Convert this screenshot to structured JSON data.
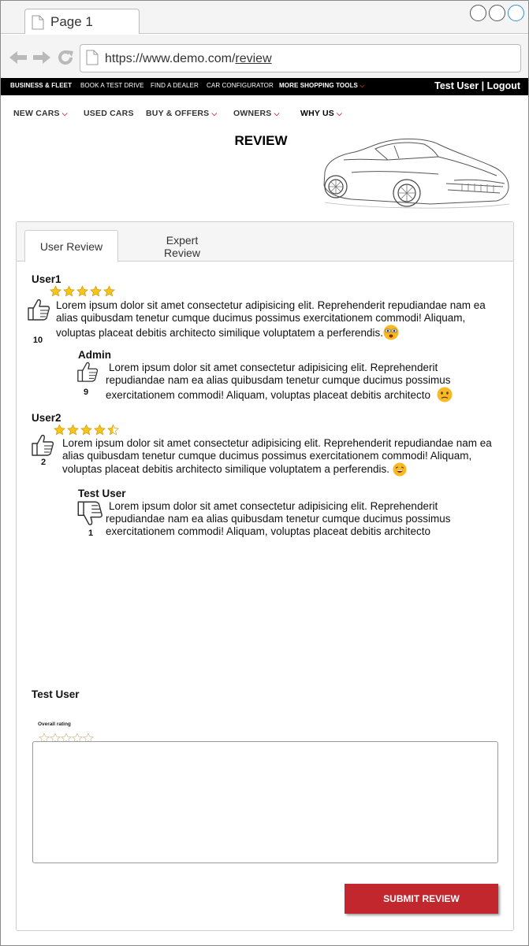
{
  "browser": {
    "tab_title": "Page 1",
    "url_base": "https://www.demo.com/",
    "url_path": "review"
  },
  "topbar": {
    "items": [
      "BUSINESS & FLEET",
      "BOOK A TEST DRIVE",
      "FIND A DEALER",
      "CAR CONFIGURATOR",
      "MORE SHOPPING TOOLS"
    ],
    "user_name": "Test User",
    "separator": "|",
    "logout": "Logout"
  },
  "mainnav": {
    "items": [
      "NEW CARS",
      "USED CARS",
      "BUY & OFFERS",
      "OWNERS",
      "WHY US"
    ]
  },
  "page": {
    "title": "REVIEW"
  },
  "review_tabs": {
    "user": "User Review",
    "expert_line1": "Expert",
    "expert_line2": "Review"
  },
  "reviews": [
    {
      "user": "User1",
      "rating": 5,
      "text": "Lorem ipsum dolor sit amet consectetur adipisicing elit. Reprehenderit repudiandae nam ea alias quibusdam tenetur cumque ducimus possimus exercitationem commodi! Aliquam, voluptas placeat debitis architecto similique voluptatem a perferendis.",
      "likes": "10",
      "emoji": "emoji-cool",
      "reply": {
        "user": "Admin",
        "text": "Lorem ipsum dolor sit amet consectetur adipisicing elit. Reprehenderit repudiandae nam ea alias quibusdam tenetur cumque ducimus possimus exercitationem commodi! Aliquam, voluptas placeat debitis architecto",
        "likes": "9",
        "emoji": "emoji-confused"
      }
    },
    {
      "user": "User2",
      "rating": 4.5,
      "text": "Lorem ipsum dolor sit amet consectetur adipisicing elit. Reprehenderit repudiandae nam ea alias quibusdam tenetur cumque ducimus possimus exercitationem commodi! Aliquam, voluptas placeat debitis architecto similique voluptatem a perferendis.",
      "likes": "2",
      "emoji": "emoji-laughing",
      "reply": {
        "user": "Test User",
        "text": "Lorem ipsum dolor sit amet consectetur adipisicing elit. Reprehenderit repudiandae nam ea alias quibusdam tenetur cumque ducimus possimus exercitationem commodi! Aliquam, voluptas placeat debitis architecto",
        "likes": "1",
        "reaction": "thumbs-down"
      }
    }
  ],
  "composer": {
    "user": "Test User",
    "overall_label": "Overall rating",
    "rating": 0,
    "text_value": "",
    "submit_label": "SUBMIT REVIEW"
  },
  "colors": {
    "accent_red": "#c1272d",
    "star_gold": "#f5c518",
    "topbar_bg": "#000000"
  }
}
